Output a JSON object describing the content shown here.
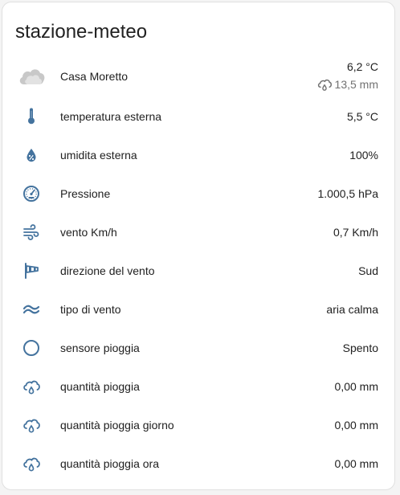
{
  "card": {
    "title": "stazione-meteo"
  },
  "weather": {
    "name": "Casa Moretto",
    "temperature": "6,2 °C",
    "precipitation": "13,5 mm"
  },
  "rows": [
    {
      "icon": "thermometer-icon",
      "label": "temperatura esterna",
      "value": "5,5 °C"
    },
    {
      "icon": "water-percent-icon",
      "label": "umidita esterna",
      "value": "100%"
    },
    {
      "icon": "gauge-icon",
      "label": "Pressione",
      "value": "1.000,5 hPa"
    },
    {
      "icon": "wind-icon",
      "label": "vento Km/h",
      "value": "0,7 Km/h"
    },
    {
      "icon": "windsock-icon",
      "label": "direzione del vento",
      "value": "Sud"
    },
    {
      "icon": "waves-icon",
      "label": "tipo di vento",
      "value": "aria calma"
    },
    {
      "icon": "circle-outline-icon",
      "label": "sensore pioggia",
      "value": "Spento"
    },
    {
      "icon": "cloud-rain-icon",
      "label": "quantità pioggia",
      "value": "0,00 mm"
    },
    {
      "icon": "cloud-rain-icon",
      "label": "quantità pioggia giorno",
      "value": "0,00 mm"
    },
    {
      "icon": "cloud-rain-icon",
      "label": "quantità pioggia ora",
      "value": "0,00 mm"
    }
  ],
  "colors": {
    "icon": "#44739e",
    "cloud": "#c8c8c8",
    "text": "#212121",
    "secondary_text": "#727272"
  }
}
